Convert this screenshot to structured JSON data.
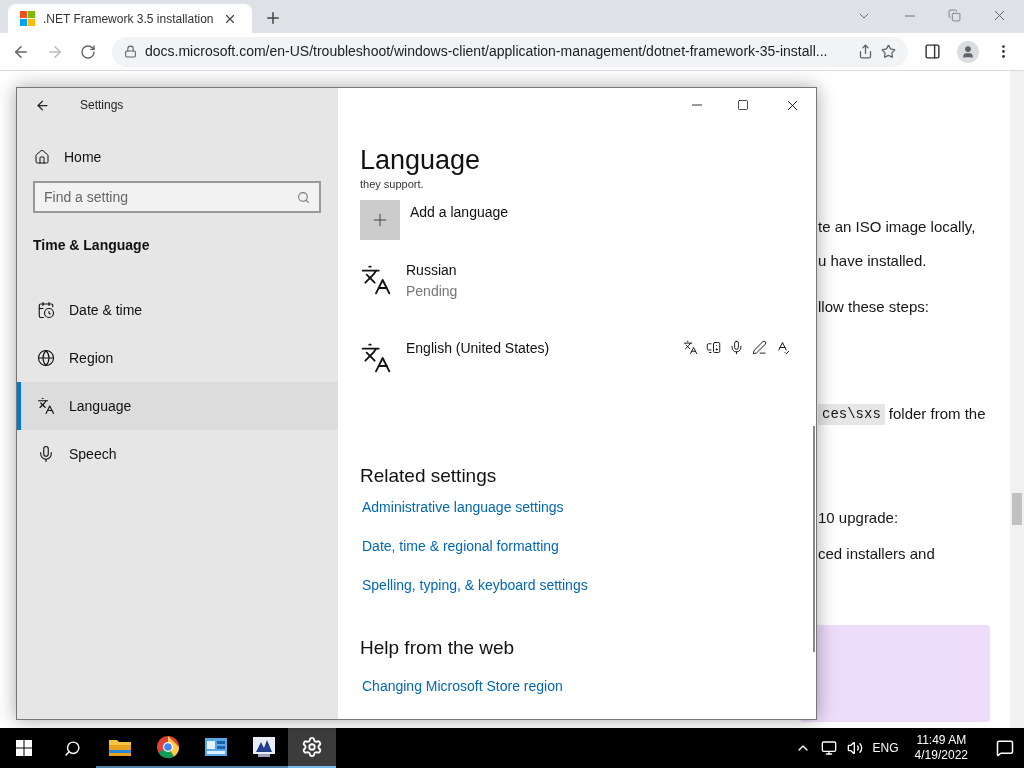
{
  "browser": {
    "tab": {
      "title": ".NET Framework 3.5 installation"
    },
    "url": "docs.microsoft.com/en-US/troubleshoot/windows-client/application-management/dotnet-framework-35-install..."
  },
  "webpage": {
    "lines": [
      {
        "text": "te an ISO image locally,"
      },
      {
        "text": "u have installed."
      },
      {
        "text": "llow these steps:"
      },
      {
        "code": "ces\\sxs",
        "text": "folder from the"
      },
      {
        "text": "10 upgrade:"
      },
      {
        "text": "ced installers and"
      }
    ]
  },
  "settings": {
    "title": "Settings",
    "home": "Home",
    "search": {
      "placeholder": "Find a setting"
    },
    "section": "Time & Language",
    "nav": [
      {
        "kind": "date",
        "label": "Date & time",
        "selected": false
      },
      {
        "kind": "region",
        "label": "Region",
        "selected": false
      },
      {
        "kind": "language",
        "label": "Language",
        "selected": true
      },
      {
        "kind": "speech",
        "label": "Speech",
        "selected": false
      }
    ],
    "page_title": "Language",
    "cut_text": "they support.",
    "add_language": "Add a language",
    "languages": [
      {
        "name": "Russian",
        "status": "Pending",
        "features_shown": false
      },
      {
        "name": "English (United States)",
        "features_shown": true
      }
    ],
    "related": {
      "heading": "Related settings",
      "links": [
        "Administrative language settings",
        "Date, time & regional formatting",
        "Spelling, typing, & keyboard settings"
      ]
    },
    "help": {
      "heading": "Help from the web",
      "links": [
        "Changing Microsoft Store region"
      ]
    }
  },
  "taskbar": {
    "apps": [
      {
        "kind": "explorer",
        "active": false
      },
      {
        "kind": "chrome",
        "active": false
      },
      {
        "kind": "app1",
        "active": false
      },
      {
        "kind": "app2",
        "active": false
      },
      {
        "kind": "settings",
        "active": true
      }
    ],
    "language": "ENG",
    "time": "11:49 AM",
    "date": "4/19/2022"
  }
}
